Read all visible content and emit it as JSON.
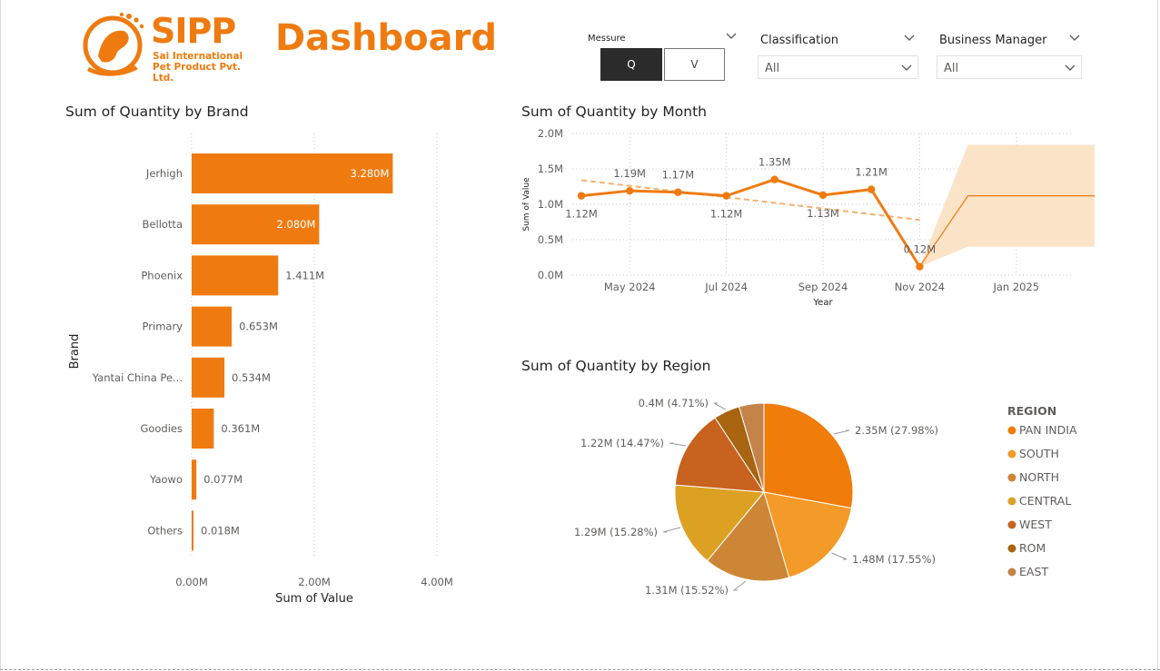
{
  "header": {
    "logo_main": "SIPP",
    "logo_sub": "Sai International Pet Product Pvt. Ltd.",
    "title": "Dashboard"
  },
  "filters": {
    "measure": {
      "label": "Messure",
      "options": [
        "Q",
        "V"
      ],
      "selected": "Q"
    },
    "classification": {
      "label": "Classification",
      "value": "All"
    },
    "business_manager": {
      "label": "Business Manager",
      "value": "All"
    }
  },
  "colors": {
    "accent": "#ef7b10",
    "forecast_band": "#fbe3c7",
    "trend": "#f5b070"
  },
  "chart_data": [
    {
      "type": "bar",
      "orientation": "horizontal",
      "title": "Sum of Quantity by Brand",
      "xlabel": "Sum of Value",
      "ylabel": "Brand",
      "categories": [
        "Jerhigh",
        "Bellotta",
        "Phoenix",
        "Primary",
        "Yantai China Pe...",
        "Goodies",
        "Yaowo",
        "Others"
      ],
      "values": [
        3.28,
        2.08,
        1.411,
        0.653,
        0.534,
        0.361,
        0.077,
        0.018
      ],
      "data_labels": [
        "3.280M",
        "2.080M",
        "1.411M",
        "0.653M",
        "0.534M",
        "0.361M",
        "0.077M",
        "0.018M"
      ],
      "xlim": [
        0,
        4
      ],
      "xticks": [
        "0.00M",
        "2.00M",
        "4.00M"
      ],
      "grid": true
    },
    {
      "type": "line",
      "title": "Sum of Quantity by Month",
      "xlabel": "Year",
      "ylabel": "Sum of Value",
      "ylim": [
        0,
        2
      ],
      "yticks": [
        "0.0M",
        "0.5M",
        "1.0M",
        "1.5M",
        "2.0M"
      ],
      "xticks": [
        "May 2024",
        "Jul 2024",
        "Sep 2024",
        "Nov 2024",
        "Jan 2025"
      ],
      "series": [
        {
          "x": [
            "2024-04",
            "2024-05",
            "2024-06",
            "2024-07",
            "2024-08",
            "2024-09",
            "2024-10",
            "2024-11"
          ],
          "values": [
            1.12,
            1.19,
            1.17,
            1.12,
            1.35,
            1.13,
            1.21,
            0.12
          ],
          "labels": [
            "1.12M",
            "1.19M",
            "1.17M",
            "1.12M",
            "1.35M",
            "1.13M",
            "1.21M",
            "0.12M"
          ]
        }
      ],
      "trend_line": {
        "start": 1.34,
        "end": 0.78
      },
      "forecast": {
        "x": [
          "2024-11",
          "2024-12",
          "2025-01",
          "2025-02",
          "2025-03"
        ],
        "values": [
          0.12,
          1.12,
          1.12,
          1.12,
          1.12
        ],
        "upper": [
          0.12,
          1.84,
          1.84,
          1.84,
          1.84
        ],
        "lower": [
          0.12,
          0.4,
          0.4,
          0.4,
          0.4
        ]
      },
      "grid": true
    },
    {
      "type": "pie",
      "title": "Sum of Quantity by Region",
      "legend_title": "REGION",
      "legend_position": "right",
      "slices": [
        {
          "name": "PAN INDIA",
          "value": 2.35,
          "percent": 27.98,
          "label": "2.35M (27.98%)",
          "color": "#f07c0a"
        },
        {
          "name": "SOUTH",
          "value": 1.48,
          "percent": 17.55,
          "label": "1.48M (17.55%)",
          "color": "#f39a28"
        },
        {
          "name": "NORTH",
          "value": 1.31,
          "percent": 15.52,
          "label": "1.31M (15.52%)",
          "color": "#cd8636"
        },
        {
          "name": "CENTRAL",
          "value": 1.29,
          "percent": 15.28,
          "label": "1.29M (15.28%)",
          "color": "#dca023"
        },
        {
          "name": "WEST",
          "value": 1.22,
          "percent": 14.47,
          "label": "1.22M (14.47%)",
          "color": "#c7621f"
        },
        {
          "name": "ROM",
          "value": 0.4,
          "percent": 4.71,
          "label": "0.4M (4.71%)",
          "color": "#a86411"
        },
        {
          "name": "EAST",
          "value": 0.38,
          "percent": 4.49,
          "label": "",
          "color": "#c48449"
        }
      ]
    }
  ]
}
